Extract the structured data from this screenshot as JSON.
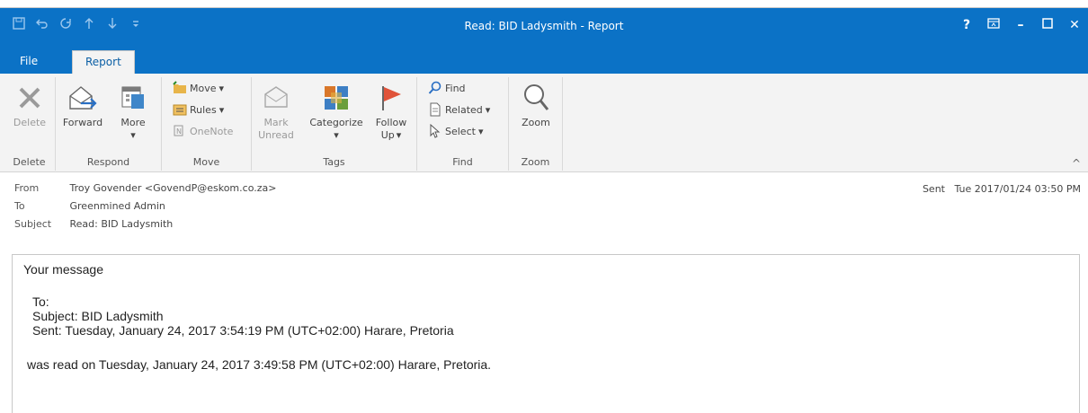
{
  "window": {
    "title": "Read: BID Ladysmith - Report",
    "accent": "#0b72c6",
    "quick_access": [
      "save-icon",
      "undo-icon",
      "redo-icon",
      "arrow-up-icon",
      "arrow-down-icon",
      "customize-icon"
    ],
    "controls": {
      "help": "?",
      "restore": "⧉",
      "minimize": "–",
      "maximize": "☐",
      "close": "✕"
    }
  },
  "tabs": [
    {
      "label": "File"
    },
    {
      "label": "Report"
    }
  ],
  "ribbon": {
    "groups": {
      "delete": {
        "label": "Delete",
        "buttons": {
          "delete": "Delete"
        }
      },
      "respond": {
        "label": "Respond",
        "buttons": {
          "forward": "Forward",
          "more": "More"
        }
      },
      "move": {
        "label": "Move",
        "buttons": {
          "move": "Move",
          "rules": "Rules",
          "onenote": "OneNote"
        }
      },
      "tags": {
        "label": "Tags",
        "buttons": {
          "mark_unread_1": "Mark",
          "mark_unread_2": "Unread",
          "categorize": "Categorize",
          "follow_up_1": "Follow",
          "follow_up_2": "Up"
        }
      },
      "find": {
        "label": "Find",
        "buttons": {
          "find": "Find",
          "related": "Related",
          "select": "Select"
        }
      },
      "zoom": {
        "label": "Zoom",
        "buttons": {
          "zoom": "Zoom"
        }
      }
    }
  },
  "header": {
    "from_label": "From",
    "from_value": "Troy Govender <GovendP@eskom.co.za>",
    "to_label": "To",
    "to_value": "Greenmined Admin",
    "subject_label": "Subject",
    "subject_value": "Read: BID Ladysmith",
    "sent_label": "Sent",
    "sent_value": "Tue 2017/01/24 03:50 PM"
  },
  "body": {
    "intro": "Your message",
    "to": "To:",
    "subject": "Subject: BID Ladysmith",
    "sent": "Sent: Tuesday, January 24, 2017 3:54:19 PM (UTC+02:00) Harare, Pretoria",
    "read": "was read on Tuesday, January 24, 2017 3:49:58 PM (UTC+02:00) Harare, Pretoria."
  }
}
